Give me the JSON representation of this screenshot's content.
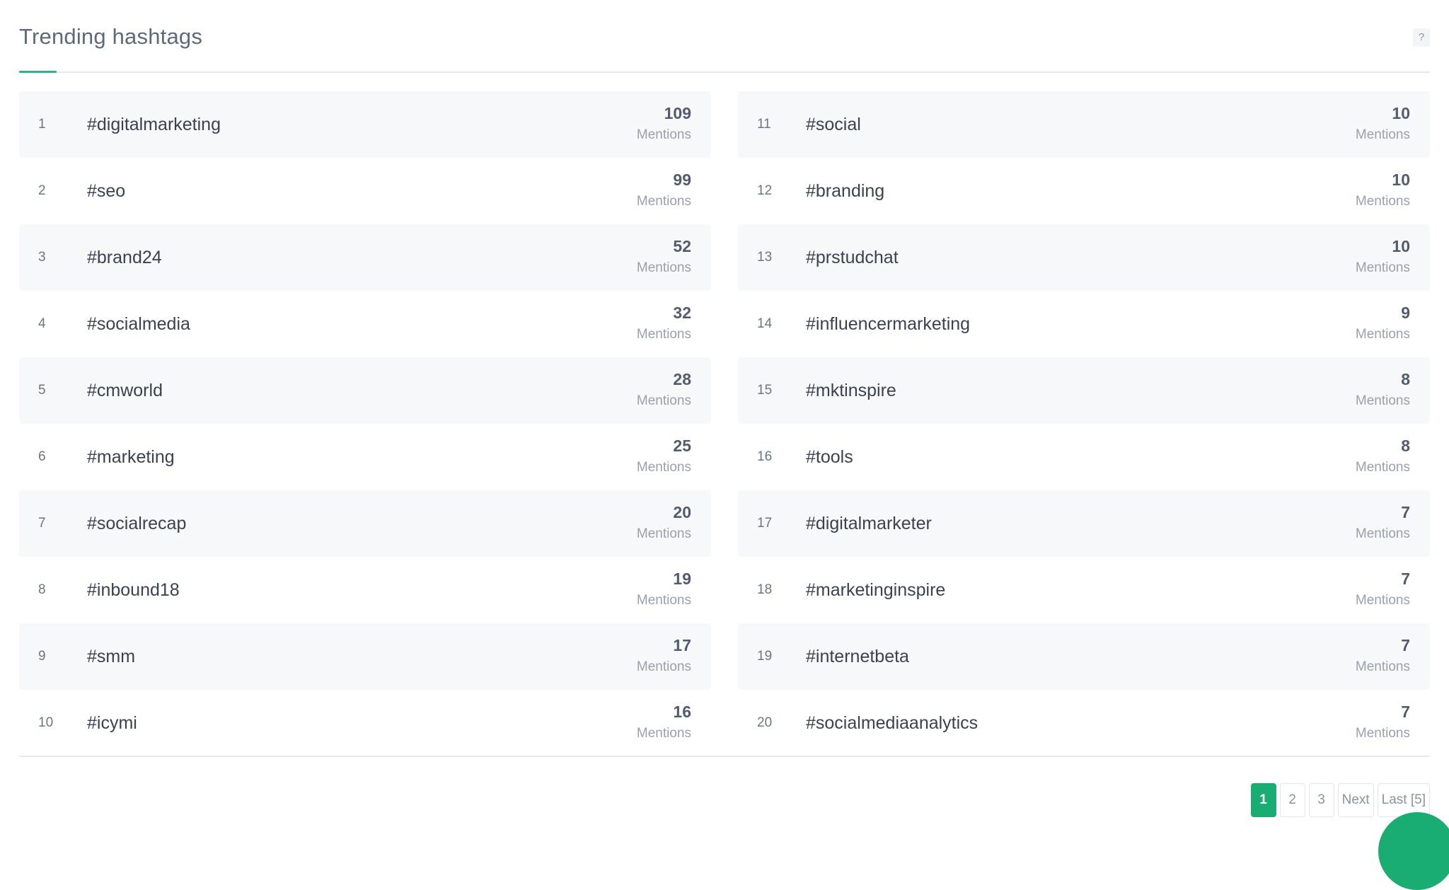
{
  "header": {
    "title": "Trending hashtags",
    "help_label": "?"
  },
  "hashtags": {
    "left": [
      {
        "rank": "1",
        "tag": "#digitalmarketing",
        "count": "109",
        "unit": "Mentions"
      },
      {
        "rank": "2",
        "tag": "#seo",
        "count": "99",
        "unit": "Mentions"
      },
      {
        "rank": "3",
        "tag": "#brand24",
        "count": "52",
        "unit": "Mentions"
      },
      {
        "rank": "4",
        "tag": "#socialmedia",
        "count": "32",
        "unit": "Mentions"
      },
      {
        "rank": "5",
        "tag": "#cmworld",
        "count": "28",
        "unit": "Mentions"
      },
      {
        "rank": "6",
        "tag": "#marketing",
        "count": "25",
        "unit": "Mentions"
      },
      {
        "rank": "7",
        "tag": "#socialrecap",
        "count": "20",
        "unit": "Mentions"
      },
      {
        "rank": "8",
        "tag": "#inbound18",
        "count": "19",
        "unit": "Mentions"
      },
      {
        "rank": "9",
        "tag": "#smm",
        "count": "17",
        "unit": "Mentions"
      },
      {
        "rank": "10",
        "tag": "#icymi",
        "count": "16",
        "unit": "Mentions"
      }
    ],
    "right": [
      {
        "rank": "11",
        "tag": "#social",
        "count": "10",
        "unit": "Mentions"
      },
      {
        "rank": "12",
        "tag": "#branding",
        "count": "10",
        "unit": "Mentions"
      },
      {
        "rank": "13",
        "tag": "#prstudchat",
        "count": "10",
        "unit": "Mentions"
      },
      {
        "rank": "14",
        "tag": "#influencermarketing",
        "count": "9",
        "unit": "Mentions"
      },
      {
        "rank": "15",
        "tag": "#mktinspire",
        "count": "8",
        "unit": "Mentions"
      },
      {
        "rank": "16",
        "tag": "#tools",
        "count": "8",
        "unit": "Mentions"
      },
      {
        "rank": "17",
        "tag": "#digitalmarketer",
        "count": "7",
        "unit": "Mentions"
      },
      {
        "rank": "18",
        "tag": "#marketinginspire",
        "count": "7",
        "unit": "Mentions"
      },
      {
        "rank": "19",
        "tag": "#internetbeta",
        "count": "7",
        "unit": "Mentions"
      },
      {
        "rank": "20",
        "tag": "#socialmediaanalytics",
        "count": "7",
        "unit": "Mentions"
      }
    ]
  },
  "pagination": {
    "pages": [
      "1",
      "2",
      "3"
    ],
    "current": "1",
    "next_label": "Next",
    "last_label": "Last [5]"
  },
  "colors": {
    "accent": "#1aad73",
    "tab_underline": "#2bb389",
    "row_shade": "#f7f8f9"
  }
}
